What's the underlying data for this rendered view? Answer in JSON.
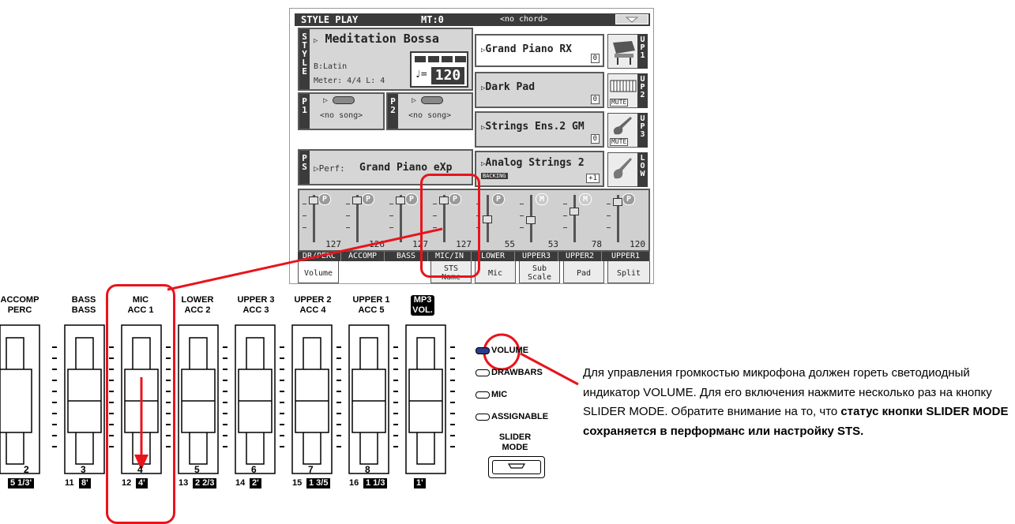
{
  "colors": {
    "accent": "#e8141c",
    "lcd_dark": "#3b3b3b",
    "lcd_panel": "#d6d6d6",
    "led_on": "#2a3c8a"
  },
  "display": {
    "header": {
      "title": "STYLE PLAY",
      "mt": "MT:0",
      "chord": "<no chord>"
    },
    "style": {
      "tag": "STYLE",
      "name": "Meditation Bossa",
      "bank": "B:Latin",
      "meter": "Meter: 4/4  L: 4",
      "tempo_symbol": "♩=",
      "tempo": "120"
    },
    "player1": {
      "tag": "P1",
      "song": "<no song>"
    },
    "player2": {
      "tag": "P2",
      "song": "<no song>"
    },
    "perf": {
      "tag": "PS",
      "label": "Perf:",
      "name": "Grand Piano eXp"
    },
    "tracks": [
      {
        "name": "Grand Piano RX",
        "tag": "UP1",
        "octave": "0",
        "mute": ""
      },
      {
        "name": "Dark Pad",
        "tag": "UP2",
        "octave": "0",
        "mute": "MUTE"
      },
      {
        "name": "Strings Ens.2 GM",
        "tag": "UP3",
        "octave": "0",
        "mute": "MUTE"
      },
      {
        "name": "Analog Strings 2",
        "tag": "LOW",
        "octave": "+1",
        "mute": "",
        "sub": "BACKING"
      }
    ],
    "mixer": [
      {
        "button": "P",
        "value": "127",
        "level": 0.98,
        "name": "DR/PERC"
      },
      {
        "button": "P",
        "value": "126",
        "level": 0.97,
        "name": "ACCOMP"
      },
      {
        "button": "P",
        "value": "127",
        "level": 0.98,
        "name": "BASS"
      },
      {
        "button": "P",
        "value": "127",
        "level": 0.98,
        "name": "MIC/IN"
      },
      {
        "button": "P",
        "value": "55",
        "level": 0.43,
        "name": "LOWER"
      },
      {
        "button": "M",
        "value": "53",
        "level": 0.42,
        "name": "UPPER3"
      },
      {
        "button": "M",
        "value": "78",
        "level": 0.61,
        "name": "UPPER2"
      },
      {
        "button": "P",
        "value": "120",
        "level": 0.94,
        "name": "UPPER1"
      }
    ],
    "bottom_tabs": [
      {
        "line1": "Volume",
        "line2": ""
      },
      {
        "line1": "STS",
        "line2": "Name"
      },
      {
        "line1": "Mic",
        "line2": ""
      },
      {
        "line1": "Sub",
        "line2": "Scale"
      },
      {
        "line1": "Pad",
        "line2": ""
      },
      {
        "line1": "Split",
        "line2": ""
      }
    ]
  },
  "panel": {
    "sliders": [
      {
        "top": "ACCOMP",
        "bottom": "PERC",
        "number": "2",
        "footnum": "",
        "feet": "5 1/3'"
      },
      {
        "top": "BASS",
        "bottom": "BASS",
        "number": "3",
        "footnum": "11",
        "feet": "8'"
      },
      {
        "top": "MIC",
        "bottom": "ACC 1",
        "number": "4",
        "footnum": "12",
        "feet": "4'"
      },
      {
        "top": "LOWER",
        "bottom": "ACC 2",
        "number": "5",
        "footnum": "13",
        "feet": "2 2/3"
      },
      {
        "top": "UPPER 3",
        "bottom": "ACC 3",
        "number": "6",
        "footnum": "14",
        "feet": "2'"
      },
      {
        "top": "UPPER 2",
        "bottom": "ACC 4",
        "number": "7",
        "footnum": "15",
        "feet": "1 3/5"
      },
      {
        "top": "UPPER 1",
        "bottom": "ACC 5",
        "number": "8",
        "footnum": "16",
        "feet": "1 1/3"
      },
      {
        "top": "MP3",
        "bottom": "VOL.",
        "number": "",
        "footnum": "",
        "feet": "1'"
      }
    ],
    "modes": [
      {
        "label": "VOLUME",
        "lit": true
      },
      {
        "label": "DRAWBARS",
        "lit": false
      },
      {
        "label": "MIC",
        "lit": false
      },
      {
        "label": "ASSIGNABLE",
        "lit": false
      }
    ],
    "slider_mode": {
      "line1": "SLIDER",
      "line2": "MODE"
    }
  },
  "description": {
    "plain": "Для управления громкостью микрофона должен гореть светодиодный индикатор VOLUME. Для его включения нажмите несколько раз на кнопку SLIDER MODE. Обратите внимание на то, что ",
    "bold": "статус кнопки SLIDER MODE сохраняется в перформанс или настройку STS."
  }
}
